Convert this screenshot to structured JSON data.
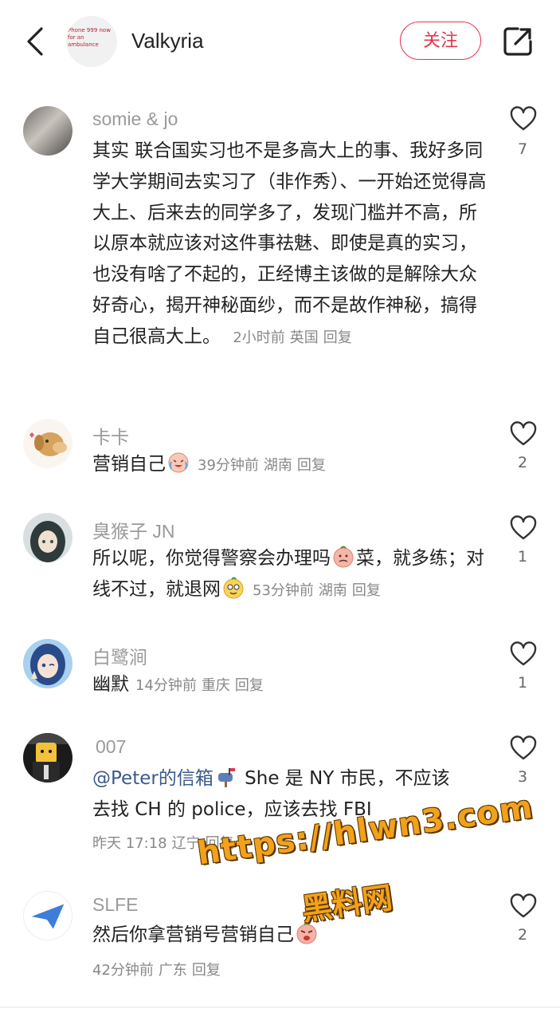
{
  "header": {
    "username": "Valkyria",
    "follow_label": "关注",
    "avatar_text": "Phone 999 now for an ambulance"
  },
  "comments": [
    {
      "name": "somie & jo",
      "text": "其实 联合国实习也不是多高大上的事、我好多同学大学期间去实习了（非作秀）、一开始还觉得高大上、后来去的同学多了，发现门槛并不高，所以原本就应该对这件事祛魅、即使是真的实习，也没有啥了不起的，正经博主该做的是解除大众好奇心，揭开神秘面纱，而不是故作神秘，搞得自己很高大上。",
      "time": "2小时前",
      "location": "英国",
      "reply": "回复",
      "likes": "7"
    },
    {
      "name": "卡卡",
      "text": "营销自己",
      "time": "39分钟前",
      "location": "湖南",
      "reply": "回复",
      "likes": "2"
    },
    {
      "name": "臭猴子 JN",
      "text_a": "所以呢，你觉得警察会办理吗",
      "text_b": "菜，就多练；对线不过，就退网",
      "time": "53分钟前",
      "location": "湖南",
      "reply": "回复",
      "likes": "1"
    },
    {
      "name": "白鹭涧",
      "text": "幽默",
      "time": "14分钟前",
      "location": "重庆",
      "reply": "回复",
      "likes": "1"
    },
    {
      "name": "007",
      "mention": "@Peter的信箱",
      "text_a": " She 是 NY 市民，不应该",
      "text_b": "去找 CH 的 police，应该去找 FBI",
      "time": "昨天 17:18",
      "location": "辽宁",
      "reply": "回复",
      "likes": "3"
    },
    {
      "name": "SLFE",
      "text": "然后你拿营销号营销自己",
      "time": "42分钟前",
      "location": "广东",
      "reply": "回复",
      "likes": "2"
    }
  ],
  "watermark": {
    "line1": "https://hlwn3.com",
    "line2": "黑料网"
  },
  "colors": {
    "accent": "#e2364e",
    "meta": "#888888",
    "name": "#9a9a9a",
    "mention": "#3a5a8c"
  }
}
